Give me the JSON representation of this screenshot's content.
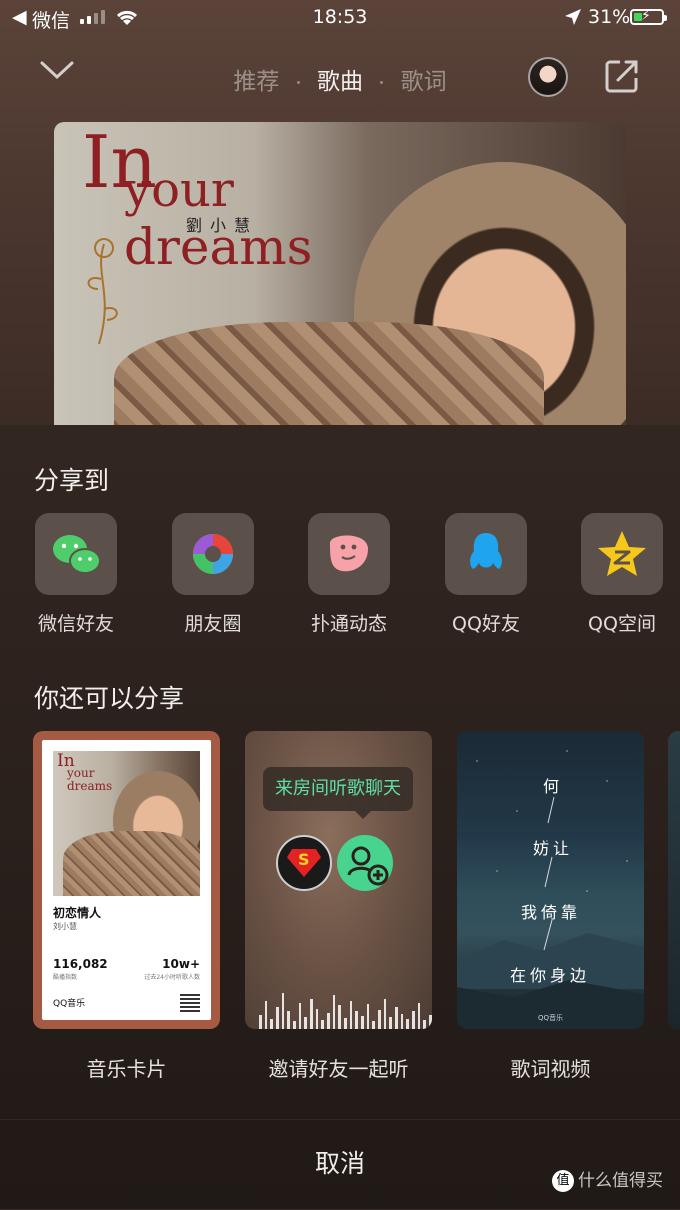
{
  "status": {
    "back_glyph": "◀",
    "carrier": "微信",
    "time": "18:53",
    "battery": "31%",
    "battery_level": 0.31
  },
  "header": {
    "tabs": [
      "推荐",
      "歌曲",
      "歌词"
    ],
    "active_tab_index": 1
  },
  "album": {
    "title_in": "In",
    "title_your": "your",
    "title_dreams": "dreams",
    "artist": "劉小慧"
  },
  "share": {
    "title": "分享到",
    "targets": [
      {
        "label": "微信好友",
        "icon": "wechat-icon",
        "color": "#4fcd6b"
      },
      {
        "label": "朋友圈",
        "icon": "moments-icon",
        "color": "#f2a33a"
      },
      {
        "label": "扑通动态",
        "icon": "putong-icon",
        "color": "#f7a1a9"
      },
      {
        "label": "QQ好友",
        "icon": "qq-icon",
        "color": "#1fa5f0"
      },
      {
        "label": "QQ空间",
        "icon": "qzone-icon",
        "color": "#f5c81b"
      }
    ]
  },
  "more": {
    "title": "你还可以分享",
    "cards": [
      {
        "label": "音乐卡片",
        "mini_title_in": "In",
        "mini_title_rest": "your dreams",
        "song": "初恋情人",
        "singer": "刘小慧",
        "plays": "116,082",
        "plays_label": "酷播指数",
        "listeners": "10w+",
        "listeners_label": "过去24小时听歌人数",
        "brand": "QQ音乐"
      },
      {
        "label": "邀请好友一起听",
        "bubble": "来房间听歌聊天"
      },
      {
        "label": "歌词视频",
        "lyrics": [
          "何",
          "妨让",
          "我倚靠",
          "在你身边"
        ],
        "brand": "QQ音乐"
      }
    ]
  },
  "cancel": "取消",
  "watermark": "什么值得买",
  "colors": {
    "accent_green": "#5fe0a7",
    "battery_green": "#43d65a"
  }
}
